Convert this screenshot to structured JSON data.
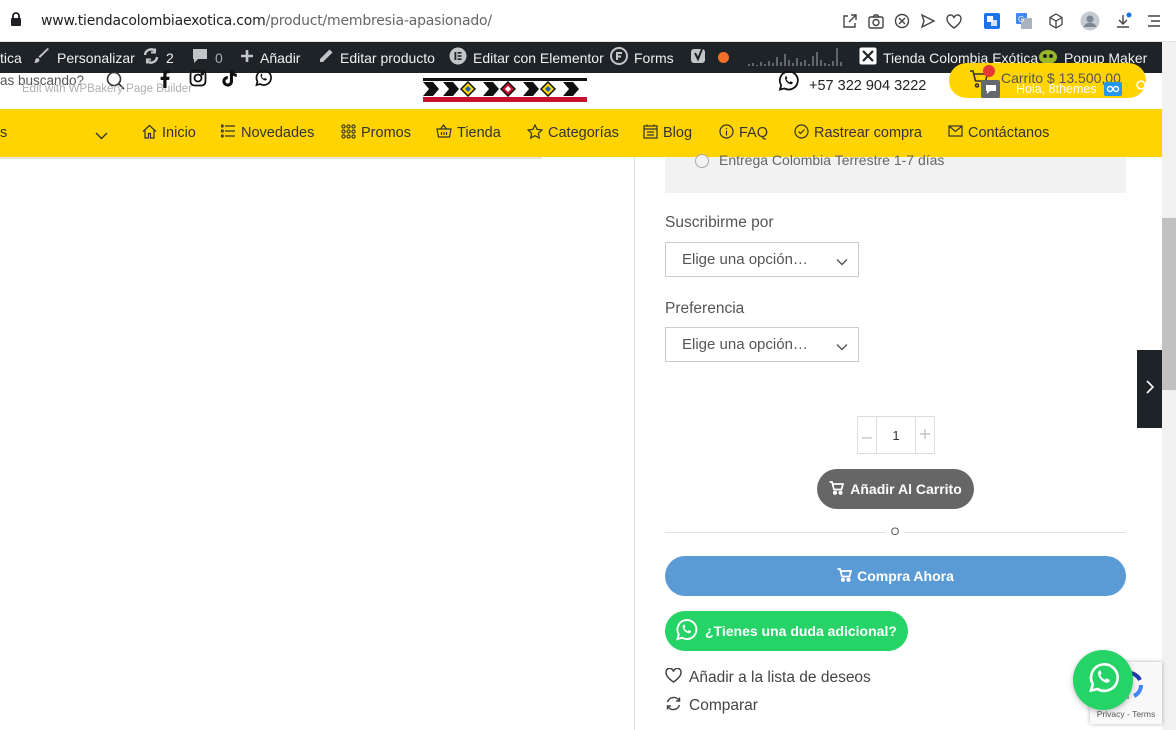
{
  "browser": {
    "url_host": "www.tiendacolombiaexotica.com",
    "url_path": "/product/membresia-apasionado/"
  },
  "adminbar": {
    "site_partial": "tica",
    "customize": "Personalizar",
    "updates_count": "2",
    "comments_count": "0",
    "add_new": "Añadir",
    "edit_product": "Editar producto",
    "edit_elementor": "Editar con Elementor",
    "forms": "Forms",
    "site_name": "Tienda Colombia Exótica",
    "popup_maker": "Popup Maker"
  },
  "header": {
    "search_placeholder": "as buscando?",
    "wpbakery_text": "Edit with WPBakery Page Builder",
    "phone": "+57 322 904 3222",
    "cart_label": "Carrito",
    "cart_total": "$ 13.500,00",
    "greeting": "Hola, 8themes"
  },
  "nav": {
    "partial": "s",
    "items": [
      "Inicio",
      "Novedades",
      "Promos",
      "Tienda",
      "Categorías",
      "Blog",
      "FAQ",
      "Rastrear compra",
      "Contáctanos"
    ]
  },
  "product": {
    "shipping_option": "Entrega Colombia Terrestre 1-7 días",
    "subscribe_label": "Suscribirme por",
    "subscribe_value": "Elige una opción…",
    "preference_label": "Preferencia",
    "preference_value": "Elige una opción…",
    "quantity": "1",
    "add_to_cart": "Añadir Al Carrito",
    "separator": "O",
    "buy_now": "Compra Ahora",
    "whatsapp_question": "¿Tienes una duda adicional?",
    "wishlist": "Añadir a la lista de deseos",
    "compare": "Comparar"
  },
  "recaptcha": {
    "text": "Privacy - Terms"
  },
  "colors": {
    "nav_bg": "#ffd400",
    "adminbar_bg": "#1d2327",
    "buy_now_bg": "#5b9bd5",
    "whatsapp_bg": "#25d366",
    "add_to_cart_bg": "#666666"
  }
}
